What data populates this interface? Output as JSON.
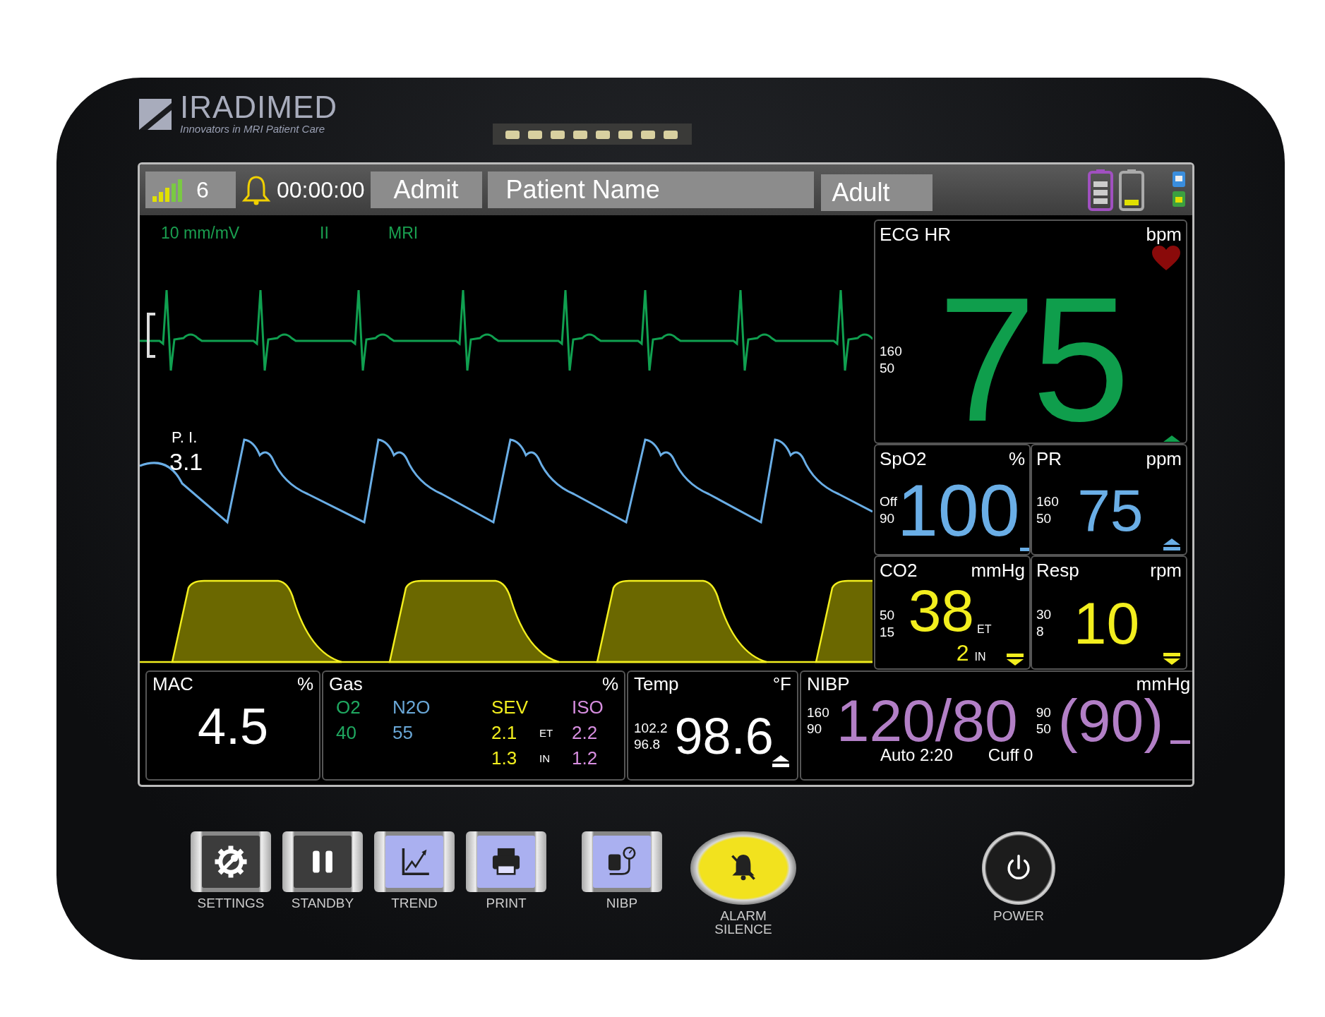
{
  "device": {
    "brand": "IRADIMED",
    "tagline": "Innovators in MRI Patient Care"
  },
  "status_bar": {
    "bed": "6",
    "timer": "00:00:00",
    "admit_button": "Admit",
    "patient_name": "Patient Name",
    "patient_type": "Adult"
  },
  "waveforms": {
    "ecg_scale": "10 mm/mV",
    "ecg_lead": "II",
    "ecg_filter": "MRI",
    "pi_label": "P. I.",
    "pi_value": "3.1"
  },
  "vitals": [
    {
      "kind": "up",
      "label": "ECG HR",
      "unit": "bpm",
      "high": "160",
      "low": "50",
      "value": "75",
      "color": "#0f9e4c"
    },
    {
      "kind": "bar",
      "label": "SpO2",
      "unit": "%",
      "high": "Off",
      "low": "90",
      "value": "100",
      "color": "#6aaee6"
    },
    {
      "kind": "up",
      "label": "PR",
      "unit": "ppm",
      "high": "160",
      "low": "50",
      "value": "75",
      "color": "#6aaee6"
    },
    {
      "kind": "down",
      "label": "CO2",
      "unit": "mmHg",
      "high": "50",
      "low": "15",
      "value": "38",
      "value_tag": "ET",
      "secondary": "2",
      "secondary_tag": "IN",
      "color": "#f2ee1e"
    },
    {
      "kind": "down",
      "label": "Resp",
      "unit": "rpm",
      "high": "30",
      "low": "8",
      "value": "10",
      "color": "#f2ee1e"
    }
  ],
  "mac": {
    "label": "MAC",
    "unit": "%",
    "value": "4.5"
  },
  "gas": {
    "label": "Gas",
    "unit": "%",
    "et_tag": "ET",
    "in_tag": "IN",
    "primary": [
      {
        "name": "O2",
        "et": "40",
        "color": "#1fa860"
      },
      {
        "name": "N2O",
        "et": "55",
        "color": "#6aa8d8"
      }
    ],
    "anesthetic": [
      {
        "name": "SEV",
        "et": "2.1",
        "in": "1.3",
        "color": "#f2ee1e"
      },
      {
        "name": "ISO",
        "et": "2.2",
        "in": "1.2",
        "color": "#d78ee0"
      }
    ]
  },
  "temp": {
    "label": "Temp",
    "unit": "°F",
    "high": "102.2",
    "low": "96.8",
    "value": "98.6"
  },
  "nibp": {
    "label": "NIBP",
    "unit": "mmHg",
    "high": "160",
    "low": "90",
    "value": "120/80",
    "map_high": "90",
    "map_low": "50",
    "map_value": "(90)",
    "mode": "Auto 2:20",
    "cuff": "Cuff 0"
  },
  "keys": [
    {
      "kind": "settings",
      "label": "SETTINGS"
    },
    {
      "kind": "standby",
      "label": "STANDBY"
    },
    {
      "kind": "trend",
      "label": "TREND"
    },
    {
      "kind": "print",
      "label": "PRINT"
    },
    {
      "kind": "nibp",
      "label": "NIBP"
    },
    {
      "kind": "alarm",
      "label": "ALARM SILENCE"
    },
    {
      "kind": "power",
      "label": "POWER"
    }
  ]
}
